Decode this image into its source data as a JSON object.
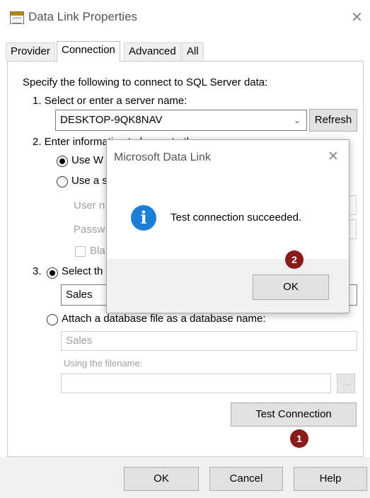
{
  "window": {
    "title": "Data Link Properties"
  },
  "tabs": [
    "Provider",
    "Connection",
    "Advanced",
    "All"
  ],
  "connection": {
    "intro": "Specify the following to connect to SQL Server data:",
    "step1_label": "1. Select or enter a server name:",
    "server_name": "DESKTOP-9QK8NAV",
    "refresh_label": "Refresh",
    "step2_label": "2. Enter information to log on to the server:",
    "use_windows_label": "Use W",
    "use_specific_label": "Use a s",
    "user_name_label": "User n",
    "password_label": "Passw",
    "blank_label": "Bla",
    "step3_prefix": "3.",
    "select_db_label": "Select th",
    "database": "Sales",
    "attach_label": "Attach a database file as a database name:",
    "attach_name": "Sales",
    "using_filename_label": "Using the filename:",
    "filename": "",
    "browse_label": "...",
    "test_connection_label": "Test Connection"
  },
  "buttons": {
    "ok": "OK",
    "cancel": "Cancel",
    "help": "Help"
  },
  "message_box": {
    "title": "Microsoft Data Link",
    "message": "Test connection succeeded.",
    "ok": "OK"
  },
  "badges": {
    "step1": "1",
    "step2": "2"
  },
  "colors": {
    "info_icon": "#1c7fd6",
    "badge": "#8b1a1a",
    "footer": "#f0f0f0"
  },
  "icons": {
    "window": "data-link-icon",
    "close": "close-icon",
    "info": "info-icon",
    "dropdown": "chevron-down-icon"
  }
}
